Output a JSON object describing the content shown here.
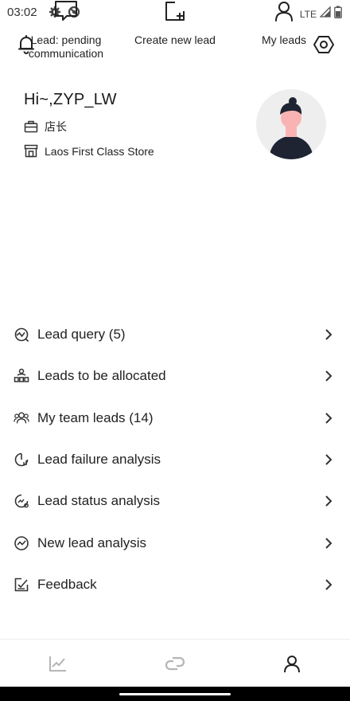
{
  "status_bar": {
    "time": "03:02",
    "network": "LTE",
    "icons": [
      "gear-icon",
      "data-saver-icon",
      "signal-icon",
      "battery-icon"
    ]
  },
  "header": {
    "icons": [
      "bell-icon",
      "settings-hex-icon"
    ]
  },
  "profile": {
    "greeting": "Hi~,ZYP_LW",
    "role": "店长",
    "store": "Laos First Class Store",
    "role_icon": "briefcase-icon",
    "store_icon": "store-icon",
    "avatar_icon": "user-avatar"
  },
  "quick_actions": [
    {
      "label": "Lead: pending communication",
      "icon": "chat-bubble-icon"
    },
    {
      "label": "Create new lead",
      "icon": "add-square-icon"
    },
    {
      "label": "My leads",
      "icon": "person-icon"
    }
  ],
  "menu": [
    {
      "label": "Lead query (5)",
      "icon": "query-chart-icon"
    },
    {
      "label": "Leads to be allocated",
      "icon": "hierarchy-icon"
    },
    {
      "label": "My team leads (14)",
      "icon": "team-icon"
    },
    {
      "label": "Lead failure analysis",
      "icon": "pie-chart-icon"
    },
    {
      "label": "Lead status analysis",
      "icon": "status-gauge-icon"
    },
    {
      "label": "New lead analysis",
      "icon": "trend-circle-icon"
    },
    {
      "label": "Feedback",
      "icon": "feedback-icon"
    }
  ],
  "bottom_nav": [
    {
      "icon": "analytics-icon",
      "active": false
    },
    {
      "icon": "link-icon",
      "active": false
    },
    {
      "icon": "profile-icon",
      "active": true
    }
  ],
  "colors": {
    "text": "#222222",
    "icon": "#333333",
    "inactive_nav": "#b5b5b5",
    "avatar_bg": "#eeeeee",
    "avatar_skin": "#f9b3b3",
    "avatar_dark": "#1f2433"
  }
}
